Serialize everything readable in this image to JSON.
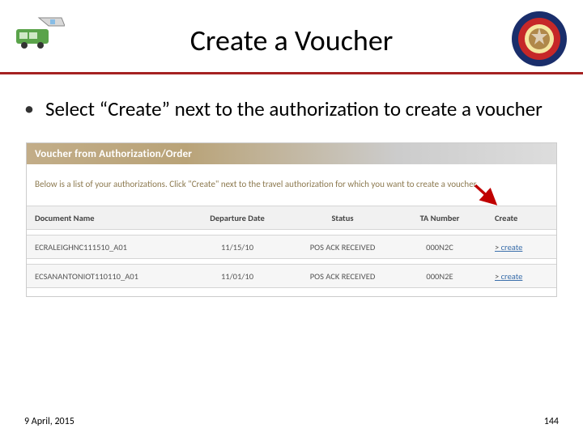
{
  "title": "Create a Voucher",
  "bullet": "Select “Create” next to the authorization to create a voucher",
  "panel": {
    "banner": "Voucher from Authorization/Order",
    "instruction": "Below is a list of your authorizations. Click \"Create\" next to the travel authorization for which you want to create a voucher."
  },
  "columns": {
    "c1": "Document Name",
    "c2": "Departure Date",
    "c3": "Status",
    "c4": "TA Number",
    "c5": "Create"
  },
  "rows": [
    {
      "doc": "ECRALEIGHNC111510_A01",
      "dep": "11/15/10",
      "status": "POS ACK RECEIVED",
      "ta": "000N2C",
      "action": "create"
    },
    {
      "doc": "ECSANANTONIOT110110_A01",
      "dep": "11/01/10",
      "status": "POS ACK RECEIVED",
      "ta": "000N2E",
      "action": "create"
    }
  ],
  "footer": {
    "date": "9 April, 2015",
    "page": "144"
  }
}
